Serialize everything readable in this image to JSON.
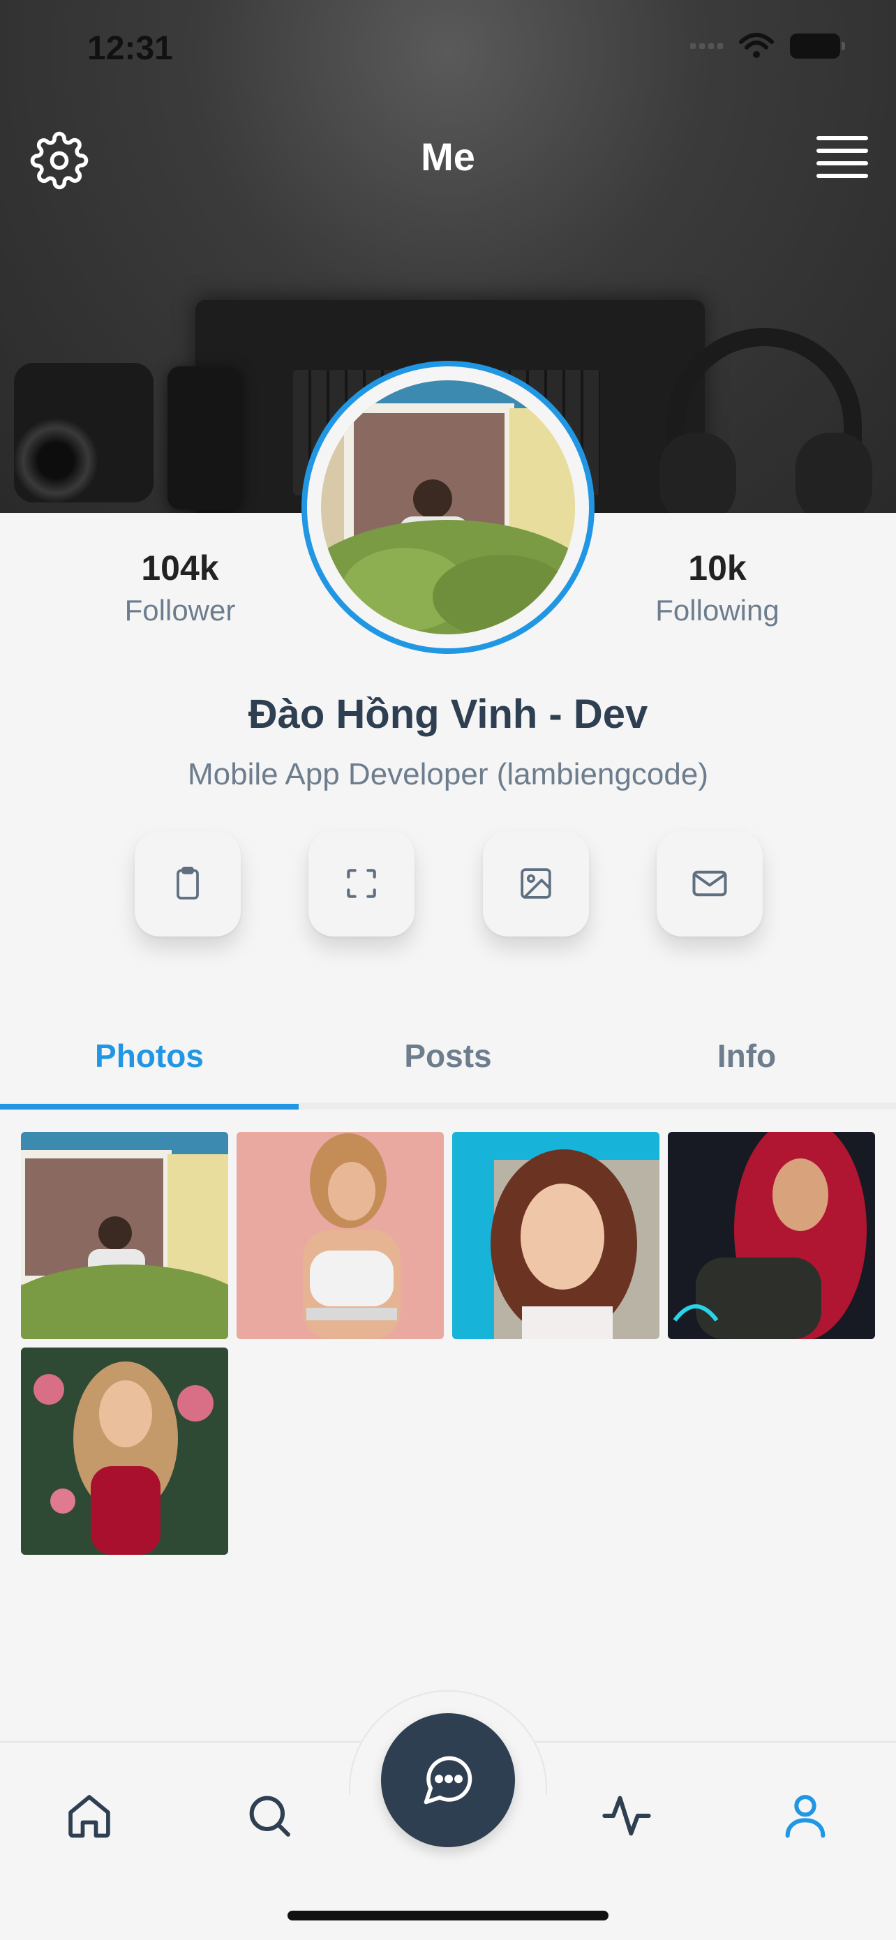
{
  "status_bar": {
    "time": "12:31"
  },
  "header": {
    "title": "Me",
    "settings_icon": "gear-icon",
    "menu_icon": "hamburger-menu-icon"
  },
  "stats": {
    "follower": {
      "value": "104k",
      "label": "Follower"
    },
    "following": {
      "value": "10k",
      "label": "Following"
    }
  },
  "profile": {
    "name": "Đào Hồng Vinh - Dev",
    "bio": "Mobile App Developer (lambiengcode)"
  },
  "actions": [
    {
      "icon": "clipboard-icon"
    },
    {
      "icon": "scan-icon"
    },
    {
      "icon": "image-icon"
    },
    {
      "icon": "mail-icon"
    }
  ],
  "tabs": [
    {
      "label": "Photos",
      "active": true
    },
    {
      "label": "Posts",
      "active": false
    },
    {
      "label": "Info",
      "active": false
    }
  ],
  "bottom_nav": [
    {
      "icon": "home-icon"
    },
    {
      "icon": "search-icon"
    },
    {
      "icon": "chat-icon"
    },
    {
      "icon": "activity-icon"
    },
    {
      "icon": "profile-icon",
      "active": true
    }
  ],
  "colors": {
    "accent": "#2196e3",
    "dark": "#2f3f52",
    "muted": "#6d7d8e",
    "background": "#f5f5f5"
  }
}
